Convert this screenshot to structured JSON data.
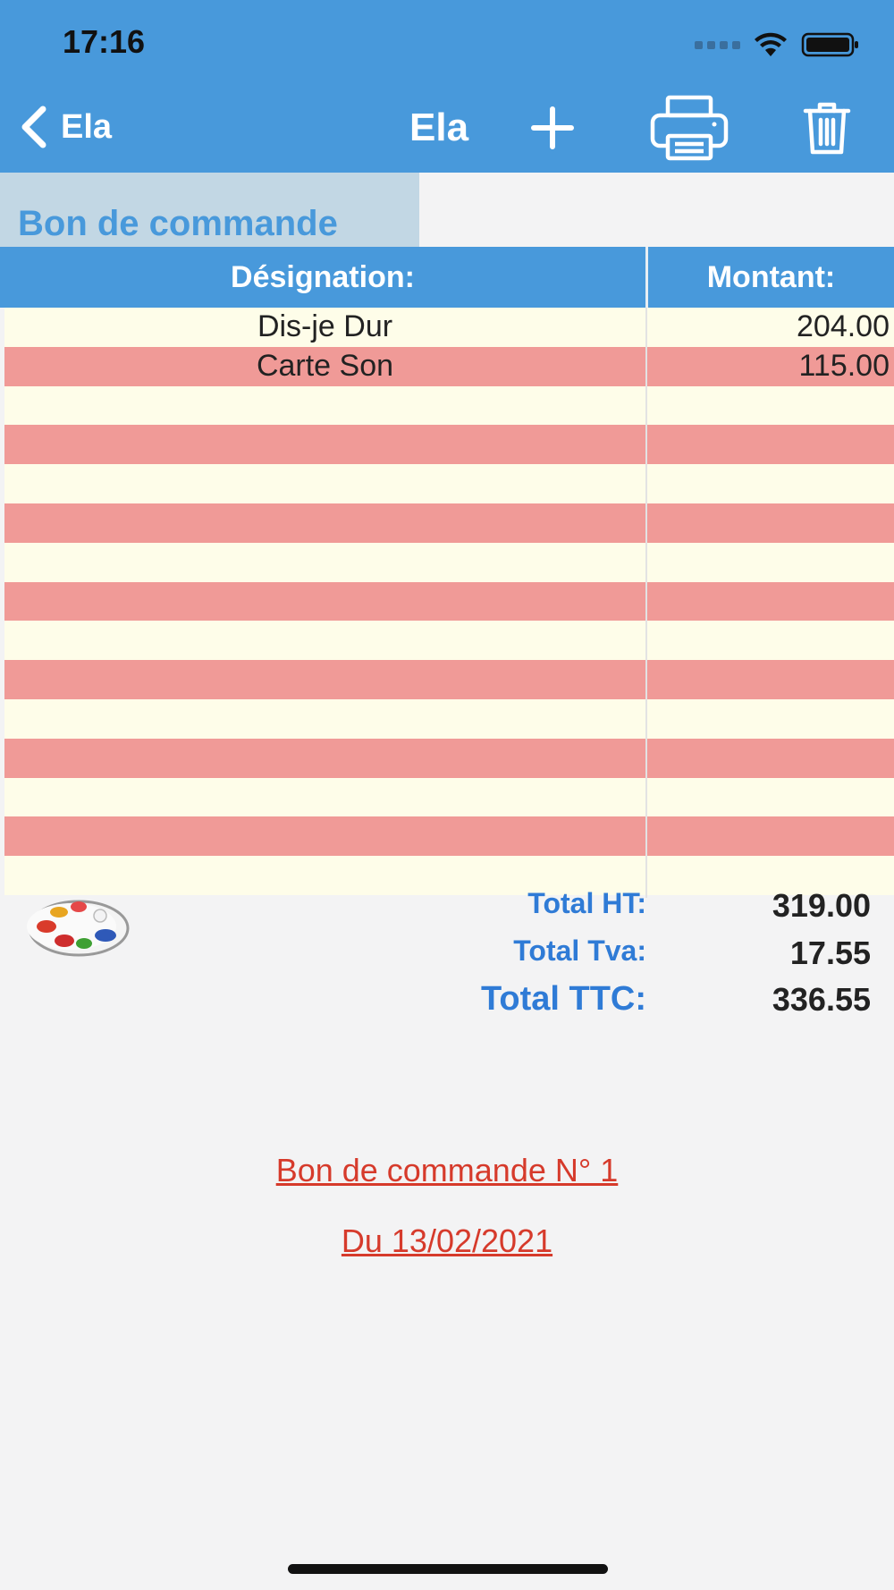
{
  "status_bar": {
    "time": "17:16"
  },
  "nav": {
    "back_label": "Ela",
    "title": "Ela",
    "icons": [
      "chevron-left-icon",
      "plus-icon",
      "printer-icon",
      "trash-icon"
    ]
  },
  "document": {
    "title": "Bon de commande"
  },
  "table": {
    "headers": {
      "designation": "Désignation:",
      "montant": "Montant:"
    },
    "rows": [
      {
        "name": "Dis-je Dur",
        "amount": "204.00"
      },
      {
        "name": "Carte Son",
        "amount": "115.00"
      },
      {
        "name": "",
        "amount": ""
      },
      {
        "name": "",
        "amount": ""
      },
      {
        "name": "",
        "amount": ""
      },
      {
        "name": "",
        "amount": ""
      },
      {
        "name": "",
        "amount": ""
      },
      {
        "name": "",
        "amount": ""
      },
      {
        "name": "",
        "amount": ""
      },
      {
        "name": "",
        "amount": ""
      },
      {
        "name": "",
        "amount": ""
      },
      {
        "name": "",
        "amount": ""
      },
      {
        "name": "",
        "amount": ""
      },
      {
        "name": "",
        "amount": ""
      },
      {
        "name": "",
        "amount": ""
      }
    ]
  },
  "totals": {
    "ht_label": "Total HT:",
    "ht_value": "319.00",
    "tva_label": "Total Tva:",
    "tva_value": "17.55",
    "ttc_label": "Total TTC:",
    "ttc_value": "336.55"
  },
  "order": {
    "number_line": "Bon de commande N° 1",
    "date_line": "Du 13/02/2021"
  },
  "colors": {
    "header": "#4899db",
    "row_cream": "#fefde9",
    "row_pink": "#f09a97",
    "totals_label": "#2f7bd6",
    "order_text": "#d63a2b"
  }
}
